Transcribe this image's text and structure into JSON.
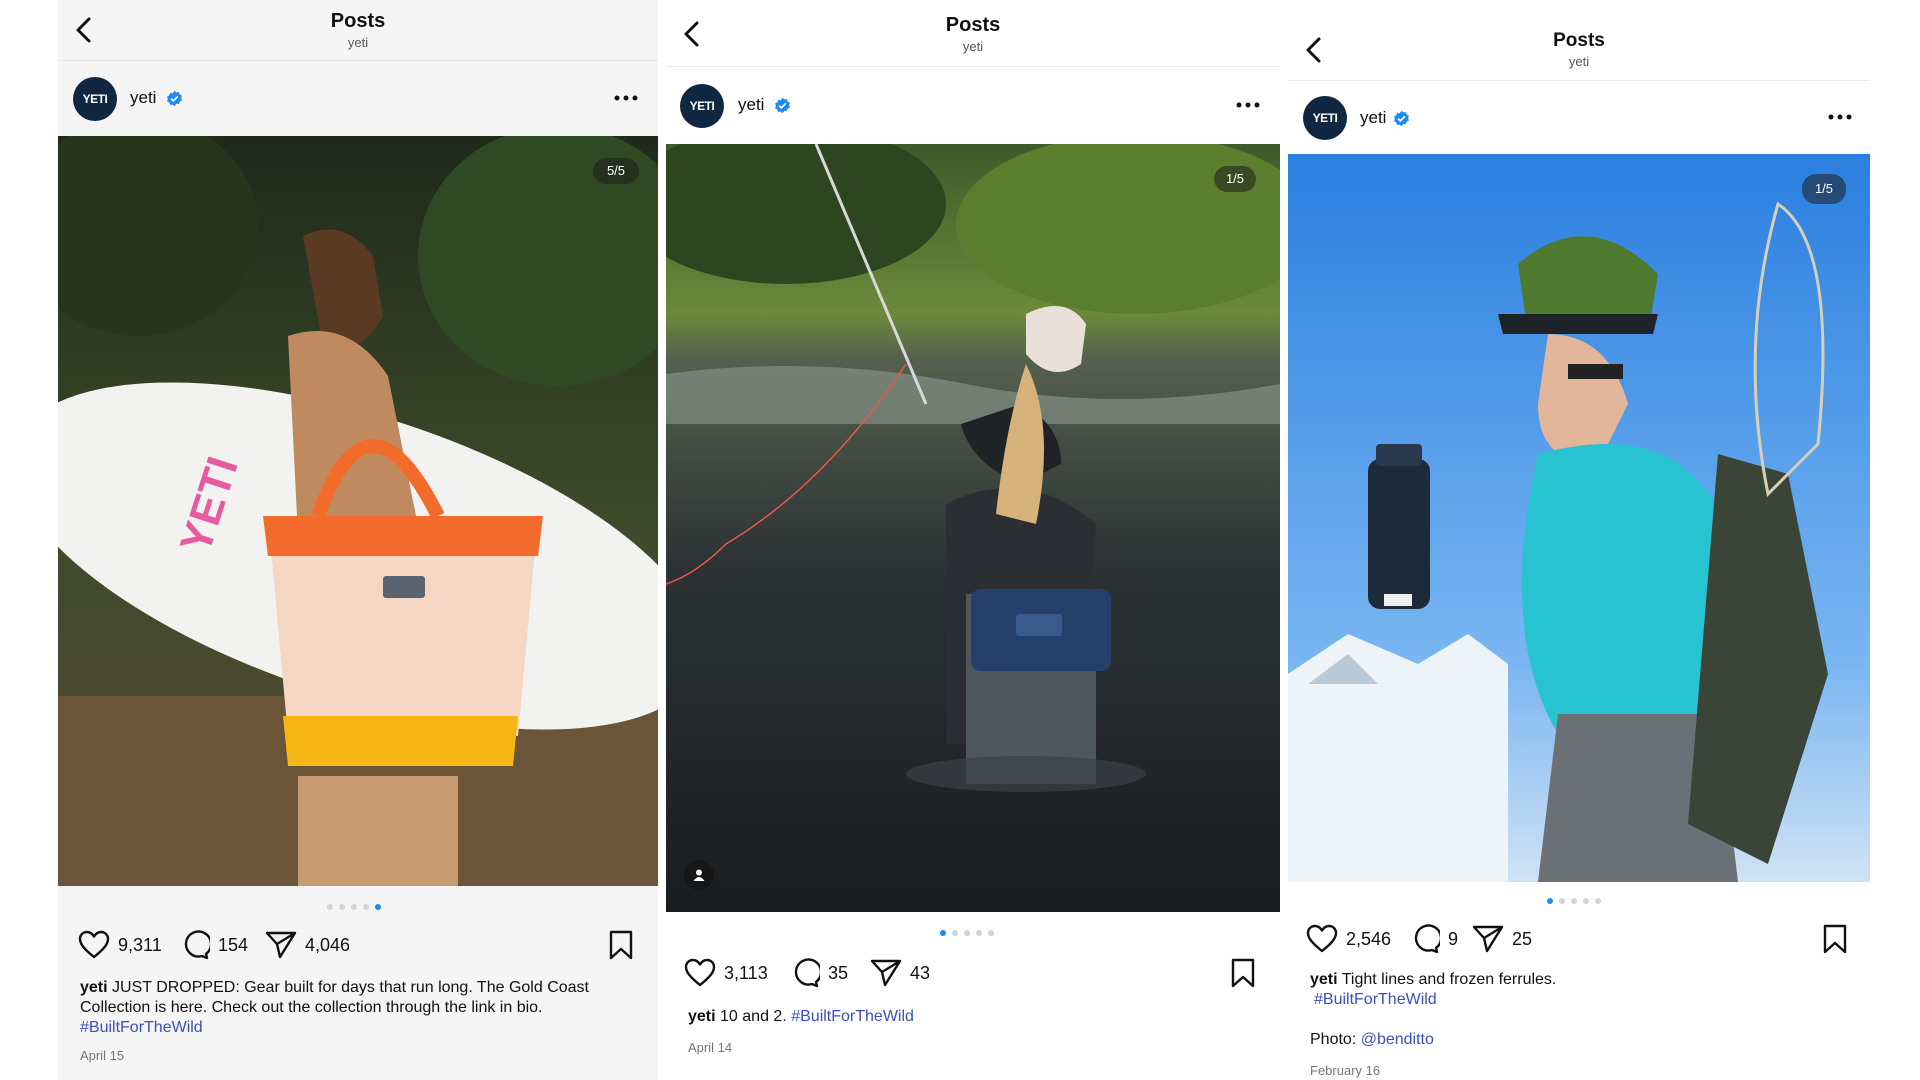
{
  "posts": [
    {
      "header": {
        "title": "Posts",
        "subtitle": "yeti"
      },
      "user": {
        "name": "yeti",
        "avatar_text": "YETI",
        "verified": true
      },
      "photo": {
        "counter": "5/5",
        "slide": 5,
        "total": 5
      },
      "actions": {
        "likes": "9,311",
        "comments": "154",
        "shares": "4,046"
      },
      "caption": {
        "user": "yeti",
        "text": "JUST DROPPED: Gear built for days that run long. The Gold Coast Collection is here. Check out the collection through the link in bio.",
        "hashtag": "#BuiltForTheWild"
      },
      "date": "April 15"
    },
    {
      "header": {
        "title": "Posts",
        "subtitle": "yeti"
      },
      "user": {
        "name": "yeti",
        "avatar_text": "YETI",
        "verified": true
      },
      "photo": {
        "counter": "1/5",
        "slide": 1,
        "total": 5
      },
      "actions": {
        "likes": "3,113",
        "comments": "35",
        "shares": "43"
      },
      "caption": {
        "user": "yeti",
        "text": "10 and 2.",
        "hashtag": "#BuiltForTheWild"
      },
      "date": "April 14"
    },
    {
      "header": {
        "title": "Posts",
        "subtitle": "yeti"
      },
      "user": {
        "name": "yeti",
        "avatar_text": "YETI",
        "verified": true
      },
      "photo": {
        "counter": "1/5",
        "slide": 1,
        "total": 5
      },
      "actions": {
        "likes": "2,546",
        "comments": "9",
        "shares": "25"
      },
      "caption": {
        "user": "yeti",
        "text": "Tight lines and frozen ferrules.",
        "hashtag": "#BuiltForTheWild",
        "credit_label": "Photo:",
        "credit_handle": "@benditto"
      },
      "date": "February 16"
    }
  ],
  "colors": {
    "verified": "#1d8bf0",
    "active_dot": "#1d8bf0",
    "hashtag": "#3a4fbf",
    "avatar": "#0f2740"
  },
  "icons": [
    "back-chevron-icon",
    "verified-badge-icon",
    "more-options-icon",
    "heart-icon",
    "comment-icon",
    "share-icon",
    "bookmark-icon",
    "tagged-user-icon"
  ]
}
